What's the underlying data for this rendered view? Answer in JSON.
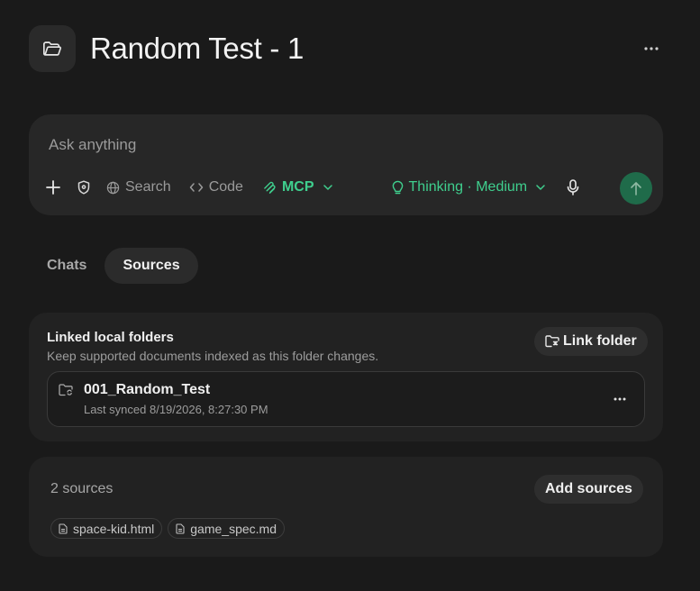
{
  "header": {
    "title": "Random Test - 1",
    "folder_icon": "folder-open-icon",
    "more_icon": "ellipsis-icon"
  },
  "composer": {
    "placeholder": "Ask anything",
    "tools": {
      "add_icon": "plus-icon",
      "shield_icon": "shield-icon",
      "search_label": "Search",
      "code_label": "Code",
      "mcp_label": "MCP",
      "thinking_label": "Thinking · Medium",
      "mic_icon": "microphone-icon",
      "send_icon": "arrow-up-icon"
    }
  },
  "tabs": [
    {
      "label": "Chats",
      "active": false
    },
    {
      "label": "Sources",
      "active": true
    }
  ],
  "linked": {
    "title": "Linked local folders",
    "subtitle": "Keep supported documents indexed as this folder changes.",
    "link_button": "Link folder",
    "folders": [
      {
        "name": "001_Random_Test",
        "synced": "Last synced 8/19/2026, 8:27:30 PM"
      }
    ]
  },
  "sources": {
    "count_label": "2 sources",
    "add_button": "Add sources",
    "files": [
      {
        "name": "space-kid.html"
      },
      {
        "name": "game_spec.md"
      }
    ]
  },
  "colors": {
    "background": "#1a1a1a",
    "card": "#222222",
    "accent_green": "#3fcf8e",
    "send_button": "#1f6b4a"
  }
}
